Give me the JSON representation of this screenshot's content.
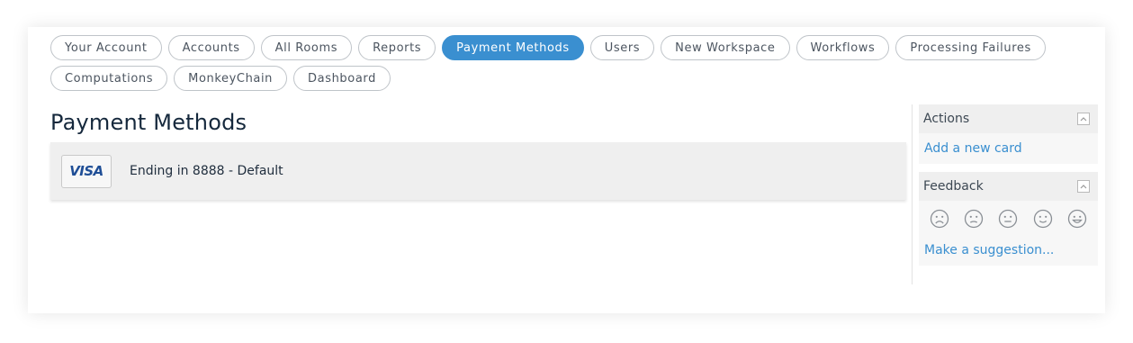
{
  "nav": {
    "row1": [
      "Your Account",
      "Accounts",
      "All Rooms",
      "Reports",
      "Payment Methods",
      "Users",
      "New Workspace",
      "Workflows",
      "Processing Failures"
    ],
    "row2": [
      "Computations",
      "MonkeyChain",
      "Dashboard"
    ],
    "active": "Payment Methods"
  },
  "page": {
    "title": "Payment Methods"
  },
  "payment_method": {
    "brand": "VISA",
    "description": "Ending in 8888 - Default"
  },
  "sidebar": {
    "actions": {
      "title": "Actions",
      "link": "Add a new card"
    },
    "feedback": {
      "title": "Feedback",
      "faces": [
        "very-sad-face-icon",
        "sad-face-icon",
        "neutral-face-icon",
        "happy-face-icon",
        "very-happy-face-icon"
      ],
      "link": "Make a suggestion..."
    }
  },
  "colors": {
    "accent": "#3a8fd0",
    "title": "#15283c"
  }
}
